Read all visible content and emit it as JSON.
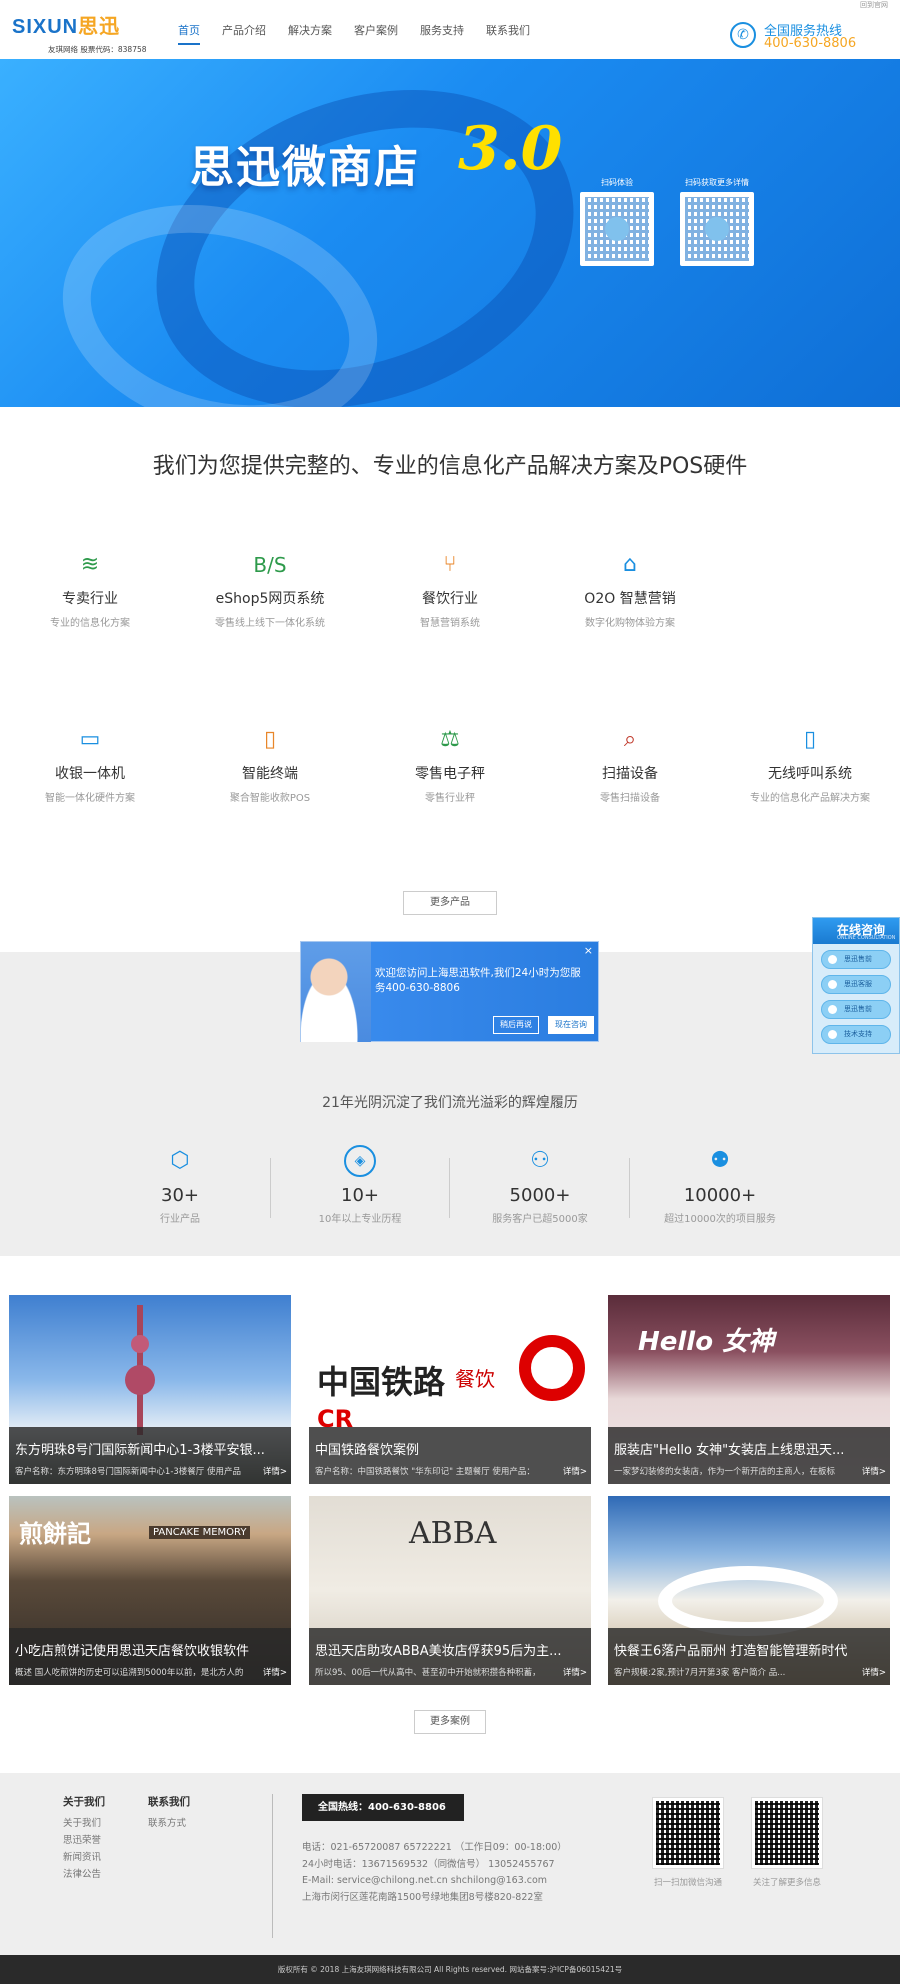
{
  "topbar": {
    "link": "回到官网"
  },
  "header": {
    "logo": {
      "brand_a": "SIXUN",
      "brand_b": "思迅",
      "sub": "友琪网络  股票代码：838758"
    },
    "nav": [
      "首页",
      "产品介绍",
      "解决方案",
      "客户案例",
      "服务支持",
      "联系我们"
    ],
    "hotline": {
      "label": "全国服务热线",
      "number": "400-630-8806"
    }
  },
  "banner": {
    "title": "思迅微商店",
    "version": "3.0",
    "qr1_caption": "扫码体验",
    "qr2_caption": "扫码获取更多详情"
  },
  "intro": "我们为您提供完整的、专业的信息化产品解决方案及POS硬件",
  "products": [
    {
      "name": "专卖行业",
      "desc": "专业的信息化方案",
      "icon": "layers-icon",
      "glyph": "≋",
      "color": "#2e9a4b"
    },
    {
      "name": "eShop5网页系统",
      "desc": "零售线上线下一体化系统",
      "icon": "bs-icon",
      "glyph": "B/S",
      "color": "#2e9a4b"
    },
    {
      "name": "餐饮行业",
      "desc": "智慧营销系统",
      "icon": "dining-icon",
      "glyph": "⑂",
      "color": "#e8862a"
    },
    {
      "name": "O2O 智慧营销",
      "desc": "数字化购物体验方案",
      "icon": "store-icon",
      "glyph": "⌂",
      "color": "#1a8fe0"
    },
    {
      "name": "收银一体机",
      "desc": "智能一体化硬件方案",
      "icon": "monitor-icon",
      "glyph": "▭",
      "color": "#1a8fe0"
    },
    {
      "name": "智能终端",
      "desc": "聚合智能收款POS",
      "icon": "tablet-icon",
      "glyph": "▯",
      "color": "#e8862a"
    },
    {
      "name": "零售电子秤",
      "desc": "零售行业秤",
      "icon": "scale-icon",
      "glyph": "⚖",
      "color": "#2e9a4b"
    },
    {
      "name": "扫描设备",
      "desc": "零售扫描设备",
      "icon": "qr-scan-icon",
      "glyph": "⌕",
      "color": "#c0392b"
    },
    {
      "name": "无线呼叫系统",
      "desc": "专业的信息化产品解决方案",
      "icon": "phone-icon",
      "glyph": "▯",
      "color": "#1a8fe0"
    }
  ],
  "more_products": "更多产品",
  "popup": {
    "message": "欢迎您访问上海思迅软件,我们24小时为您服务400-630-8806",
    "later": "稍后再说",
    "consult": "现在咨询",
    "close": "×"
  },
  "history_title": "21年光阴沉淀了我们流光溢彩的辉煌履历",
  "stats": [
    {
      "num": "30+",
      "desc": "行业产品",
      "icon": "cube-icon"
    },
    {
      "num": "10+",
      "desc": "10年以上专业历程",
      "icon": "badge-icon"
    },
    {
      "num": "5000+",
      "desc": "服务客户已超5000家",
      "icon": "handshake-icon"
    },
    {
      "num": "10000+",
      "desc": "超过10000次的项目服务",
      "icon": "users-icon"
    }
  ],
  "chat": {
    "title": "在线咨询",
    "subtitle": "ONLINE CONSULTATION",
    "buttons": [
      "思迅售前",
      "思迅客服",
      "思迅售前",
      "技术支持"
    ]
  },
  "cases": [
    {
      "title": "东方明珠8号门国际新闻中心1-3楼平安银...",
      "desc": "客户名称：东方明珠8号门国际新闻中心1-3楼餐厅 使用产品",
      "more": "详情>"
    },
    {
      "title": "中国铁路餐饮案例",
      "desc": "客户名称：中国铁路餐饮 \"华东印记\" 主题餐厅 使用产品：",
      "more": "详情>"
    },
    {
      "title": "服装店\"Hello 女神\"女装店上线思迅天...",
      "desc": "一家梦幻装修的女装店，作为一个新开店的主商人，在板标",
      "more": "详情>"
    },
    {
      "title": "小吃店煎饼记使用思迅天店餐饮收银软件",
      "desc": "概述 国人吃煎饼的历史可以追溯到5000年以前，是北方人的",
      "more": "详情>"
    },
    {
      "title": "思迅天店助攻ABBA美妆店俘获95后为主...",
      "desc": "所以95、00后一代从高中、甚至初中开始就积攒各种积蓄，",
      "more": "详情>"
    },
    {
      "title": "快餐王6落户品丽州 打造智能管理新时代",
      "desc": "客户规模:2家,预计7月开第3家 客户简介 品...",
      "more": "详情>"
    }
  ],
  "case_images": [
    "tower-photo",
    "railway-photo",
    "hello-shop-photo",
    "pancake-shop-photo",
    "abba-shop-photo",
    "restaurant-photo"
  ],
  "more_cases": "更多案例",
  "footer": {
    "about": {
      "title": "关于我们",
      "links": [
        "关于我们",
        "思迅荣誉",
        "新闻资讯",
        "法律公告"
      ]
    },
    "contact": {
      "title": "联系我们",
      "links": [
        "联系方式"
      ]
    },
    "hotline": "全国热线：400-630-8806",
    "lines": [
      "电话：021-65720087 65722221 （工作日09：00-18:00）",
      "24小时电话：13671569532（同微信号） 13052455767",
      "E-Mail: service@chilong.net.cn shchilong@163.com",
      "上海市闵行区莲花南路1500号绿地集团8号楼820-822室"
    ],
    "qr1_caption": "扫一扫加微信沟通",
    "qr2_caption": "关注了解更多信息"
  },
  "copyright": "版权所有 © 2018 上海友琪网络科技有限公司 All Rights reserved. 网站备案号:沪ICP备06015421号"
}
